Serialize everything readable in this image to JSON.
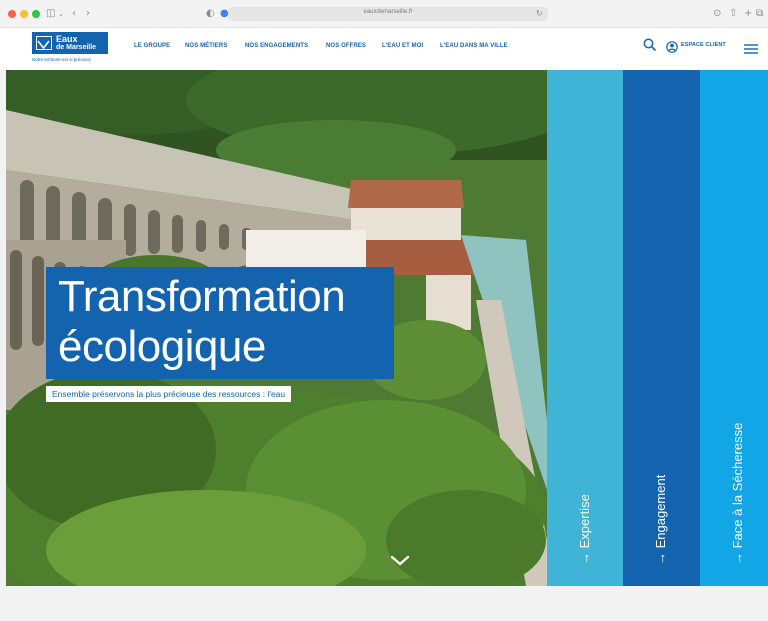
{
  "browser": {
    "address": "eauxdemarseille.fr",
    "colors": {
      "red": "#ff5f57",
      "yellow": "#febc2e",
      "green": "#28c840"
    },
    "icons": [
      "sidebar-icon",
      "back-icon",
      "forward-icon",
      "shield-icon",
      "tab-dot-icon",
      "reload-icon",
      "download-icon",
      "share-icon",
      "new-tab-icon",
      "tabs-icon"
    ]
  },
  "brand": {
    "logo_line1": "Eaux",
    "logo_line2": "de Marseille",
    "tagline": "Notre territoire est si précieux",
    "color": "#1463ae"
  },
  "nav": {
    "items": [
      {
        "label": "LE GROUPE"
      },
      {
        "label": "NOS MÉTIERS"
      },
      {
        "label": "NOS ENGAGEMENTS"
      },
      {
        "label": "NOS OFFRES"
      },
      {
        "label": "L'EAU ET MOI"
      },
      {
        "label": "L'EAU DANS MA VILLE"
      }
    ],
    "account_label": "ESPACE CLIENT"
  },
  "hero": {
    "title_line1": "Transformation",
    "title_line2": "écologique",
    "subtitle": "Ensemble préservons la plus précieuse des ressources : l'eau"
  },
  "panels": [
    {
      "label": "→ Expertise",
      "color": "#3fb4d6"
    },
    {
      "label": "→ Engagement",
      "color": "#1463ae"
    },
    {
      "label": "→ Face à la Sécheresse",
      "color": "#12a6e6"
    }
  ]
}
